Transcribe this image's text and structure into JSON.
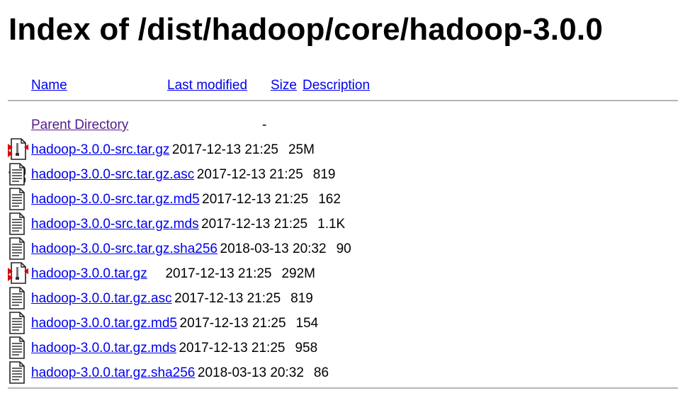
{
  "page_title": "Index of /dist/hadoop/core/hadoop-3.0.0",
  "columns": {
    "name": "Name",
    "last_modified": "Last modified",
    "size": "Size",
    "description": "Description"
  },
  "parent": {
    "name": "Parent Directory",
    "size": "-",
    "icon": "back-icon"
  },
  "files": [
    {
      "name": "hadoop-3.0.0-src.tar.gz",
      "modified": "2017-12-13 21:25",
      "size": "25M",
      "icon": "compressed-icon"
    },
    {
      "name": "hadoop-3.0.0-src.tar.gz.asc",
      "modified": "2017-12-13 21:25",
      "size": "819",
      "icon": "text-icon"
    },
    {
      "name": "hadoop-3.0.0-src.tar.gz.md5",
      "modified": "2017-12-13 21:25",
      "size": "162",
      "icon": "text-icon"
    },
    {
      "name": "hadoop-3.0.0-src.tar.gz.mds",
      "modified": "2017-12-13 21:25",
      "size": "1.1K",
      "icon": "text-icon"
    },
    {
      "name": "hadoop-3.0.0-src.tar.gz.sha256",
      "modified": "2018-03-13 20:32",
      "size": "90",
      "icon": "text-icon"
    },
    {
      "name": "hadoop-3.0.0.tar.gz",
      "modified": "2017-12-13 21:25",
      "size": "292M",
      "icon": "compressed-icon"
    },
    {
      "name": "hadoop-3.0.0.tar.gz.asc",
      "modified": "2017-12-13 21:25",
      "size": "819",
      "icon": "text-icon"
    },
    {
      "name": "hadoop-3.0.0.tar.gz.md5",
      "modified": "2017-12-13 21:25",
      "size": "154",
      "icon": "text-icon"
    },
    {
      "name": "hadoop-3.0.0.tar.gz.mds",
      "modified": "2017-12-13 21:25",
      "size": "958",
      "icon": "text-icon"
    },
    {
      "name": "hadoop-3.0.0.tar.gz.sha256",
      "modified": "2018-03-13 20:32",
      "size": "86",
      "icon": "text-icon"
    }
  ],
  "colors": {
    "link": "#0000ee",
    "visited_link": "#551a8b",
    "rule": "#b5b5b5"
  }
}
